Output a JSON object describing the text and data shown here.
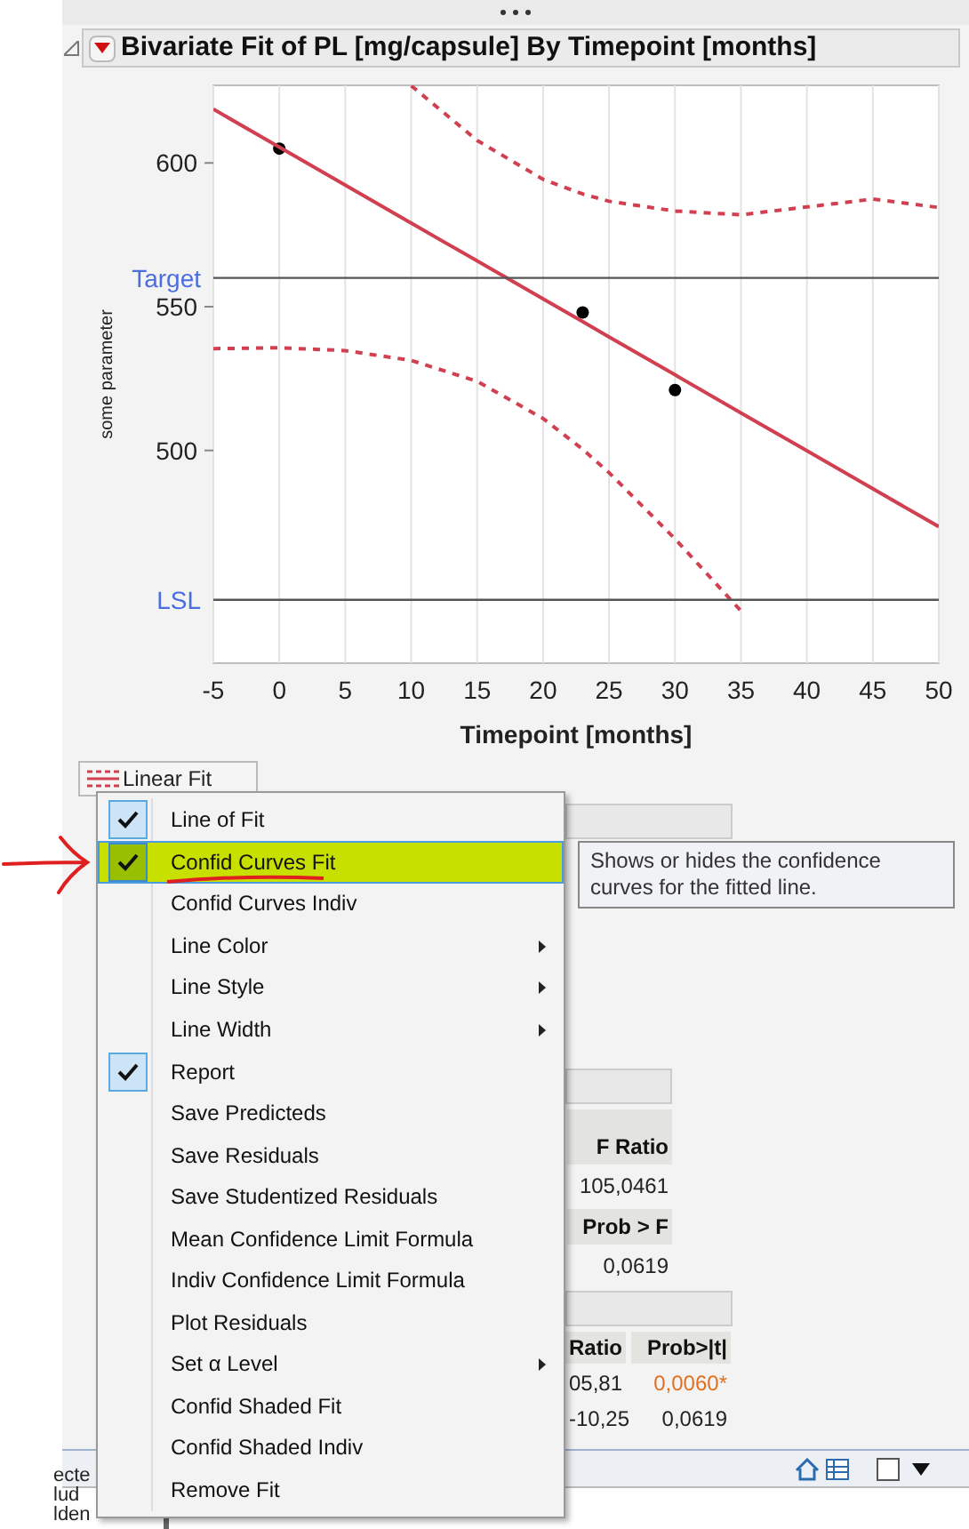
{
  "report": {
    "title": "Bivariate Fit of PL [mg/capsule] By Timepoint [months]",
    "chart_data": {
      "type": "scatter",
      "xlabel": "Timepoint [months]",
      "ylabel": "some parameter",
      "x": [
        -5,
        0,
        5,
        10,
        15,
        20,
        23,
        25,
        30,
        35,
        40,
        45,
        50
      ],
      "series": [
        {
          "color": "#000000",
          "values": [
            null,
            605,
            null,
            null,
            null,
            null,
            548,
            null,
            521,
            null,
            null,
            null,
            null
          ]
        },
        {
          "type": "line",
          "color": "#d04050",
          "values": [
            618.7,
            605.5,
            592.3,
            579.1,
            565.9,
            552.7,
            544.8,
            539.5,
            526.3,
            513.1,
            499.9,
            486.7,
            473.5
          ]
        },
        {
          "type": "line",
          "line_style": "dashed",
          "color": "#d04050",
          "values": [
            null,
            null,
            null,
            626.9,
            607.8,
            594.3,
            589.2,
            586.7,
            583.3,
            582,
            584.7,
            587.4,
            584.5
          ]
        },
        {
          "type": "line",
          "line_style": "dashed",
          "color": "#d04050",
          "values": [
            535.4,
            535.7,
            534.7,
            531.3,
            524,
            511.1,
            500.4,
            492.3,
            469.3,
            444.2,
            null,
            null,
            null
          ]
        },
        {
          "name": "Target",
          "type": "line",
          "color": "#555555",
          "values": [
            560,
            560,
            560,
            560,
            560,
            560,
            560,
            560,
            560,
            560,
            560,
            560,
            560
          ]
        },
        {
          "name": "LSL",
          "type": "line",
          "color": "#555555",
          "values": [
            448,
            448,
            448,
            448,
            448,
            448,
            448,
            448,
            448,
            448,
            448,
            448,
            448
          ]
        }
      ],
      "xlim": [
        -5,
        50
      ],
      "ylim": [
        426,
        627
      ],
      "xticks": [
        -5,
        0,
        5,
        10,
        15,
        20,
        25,
        30,
        35,
        40,
        45,
        50
      ],
      "yticks": [
        500,
        550,
        600
      ],
      "grid": true
    },
    "fit_button": {
      "label": "Linear Fit"
    },
    "tables": [
      {
        "header": "F Ratio",
        "value": "105,0461"
      },
      {
        "header": "Prob > F",
        "value": "0,0619"
      }
    ],
    "estimates": {
      "columns": [
        "Ratio",
        "Prob>|t|"
      ],
      "rows": [
        [
          "05,81",
          "0,0060*"
        ],
        [
          "-10,25",
          "0,0619"
        ]
      ],
      "significant": [
        true,
        false
      ]
    }
  },
  "menu": [
    {
      "label": "Line of Fit",
      "kind": "check",
      "checked": true,
      "selected": false
    },
    {
      "label": "Confid Curves Fit",
      "kind": "check",
      "checked": true,
      "selected": true
    },
    {
      "label": "Confid Curves Indiv",
      "kind": "check",
      "checked": false,
      "selected": false
    },
    {
      "label": "Line Color",
      "kind": "submenu",
      "selected": false
    },
    {
      "label": "Line Style",
      "kind": "submenu",
      "selected": false
    },
    {
      "label": "Line Width",
      "kind": "submenu",
      "selected": false
    },
    {
      "label": "Report",
      "kind": "check",
      "checked": true,
      "selected": false
    },
    {
      "label": "Save Predicteds",
      "kind": "check",
      "checked": false,
      "selected": false
    },
    {
      "label": "Save Residuals",
      "kind": "check",
      "checked": false,
      "selected": false
    },
    {
      "label": "Save Studentized Residuals",
      "kind": "check",
      "checked": false,
      "selected": false
    },
    {
      "label": "Mean Confidence Limit Formula",
      "kind": "check",
      "checked": false,
      "selected": false
    },
    {
      "label": "Indiv Confidence Limit Formula",
      "kind": "check",
      "checked": false,
      "selected": false
    },
    {
      "label": "Plot Residuals",
      "kind": "check",
      "checked": false,
      "selected": false
    },
    {
      "label": "Set α Level",
      "kind": "submenu",
      "selected": false
    },
    {
      "label": "Confid Shaded Fit",
      "kind": "check",
      "checked": false,
      "selected": false
    },
    {
      "label": "Confid Shaded Indiv",
      "kind": "check",
      "checked": false,
      "selected": false
    },
    {
      "label": "Remove Fit",
      "kind": "check",
      "checked": false,
      "selected": false
    }
  ],
  "tooltip": {
    "text": "Shows or hides the confidence curves for the fitted line."
  },
  "toolbar": {
    "checkbox_checked": false
  },
  "data_table": {
    "row_labels": [
      "ecte",
      "lud",
      "lden"
    ]
  }
}
